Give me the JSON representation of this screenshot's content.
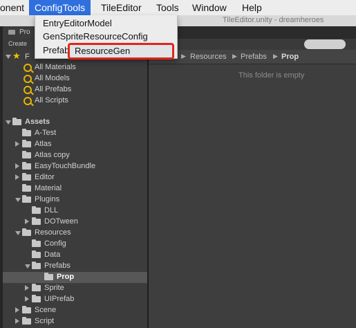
{
  "menubar": {
    "items": [
      "onent",
      "ConfigTools",
      "TileEditor",
      "Tools",
      "Window",
      "Help"
    ]
  },
  "background_window_title": "TileEditor.unity - dreamheroes",
  "dropdown": {
    "items": [
      "EntryEditorModel",
      "GenSpriteResourceConfig",
      "Prefab",
      "ResourceGen"
    ]
  },
  "project": {
    "tab_label": "Pro",
    "create_label": "Create",
    "favorites_label": "F",
    "favorites": [
      "All Materials",
      "All Models",
      "All Prefabs",
      "All Scripts"
    ],
    "tree": [
      {
        "label": "Assets"
      },
      {
        "label": "A-Test"
      },
      {
        "label": "Atlas"
      },
      {
        "label": "Atlas copy"
      },
      {
        "label": "EasyTouchBundle"
      },
      {
        "label": "Editor"
      },
      {
        "label": "Material"
      },
      {
        "label": "Plugins"
      },
      {
        "label": "DLL"
      },
      {
        "label": "DOTween"
      },
      {
        "label": "Resources"
      },
      {
        "label": "Config"
      },
      {
        "label": "Data"
      },
      {
        "label": "Prefabs"
      },
      {
        "label": "Prop"
      },
      {
        "label": "Sprite"
      },
      {
        "label": "UIPrefab"
      },
      {
        "label": "Scene"
      },
      {
        "label": "Script"
      }
    ],
    "breadcrumb": [
      "Resources",
      "Prefabs",
      "Prop"
    ],
    "empty_message": "This folder is empty"
  }
}
